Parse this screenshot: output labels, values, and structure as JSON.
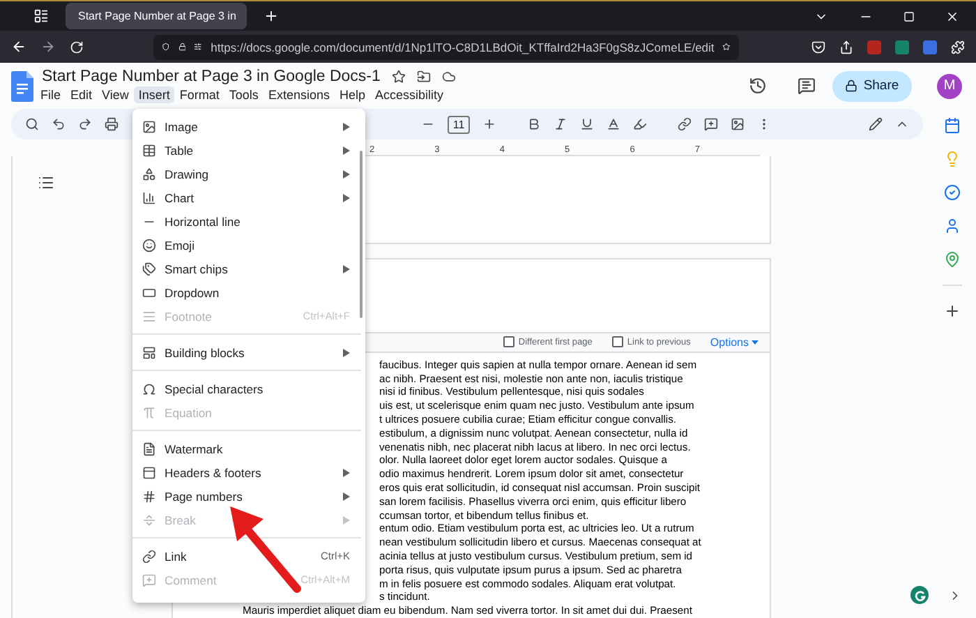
{
  "browser": {
    "tab_title": "Start Page Number at Page 3 in",
    "url": "https://docs.google.com/document/d/1Np1lTO-C8D1LBdOit_KTffaIrd2Ha3F0gS8zJComeLE/edit"
  },
  "document": {
    "title": "Start Page Number at Page 3 in Google Docs-1",
    "share_label": "Share",
    "avatar_initial": "M",
    "menus": [
      {
        "label": "File",
        "selected": false
      },
      {
        "label": "Edit",
        "selected": false
      },
      {
        "label": "View",
        "selected": false
      },
      {
        "label": "Insert",
        "selected": true
      },
      {
        "label": "Format",
        "selected": false
      },
      {
        "label": "Tools",
        "selected": false
      },
      {
        "label": "Extensions",
        "selected": false
      },
      {
        "label": "Help",
        "selected": false
      },
      {
        "label": "Accessibility",
        "selected": false
      }
    ]
  },
  "toolbar": {
    "font_size": "11"
  },
  "ruler": {
    "marks": [
      "2",
      "3",
      "4",
      "5",
      "6",
      "7"
    ]
  },
  "header_bar": {
    "options": [
      {
        "label": "Different first page",
        "checked": false
      },
      {
        "label": "Link to previous",
        "checked": false
      }
    ],
    "options_button": "Options"
  },
  "body_lines": [
    {
      "kind": "fragment",
      "text": "faucibus. Integer quis sapien at nulla tempor ornare. Aenean id sem"
    },
    {
      "kind": "fragment",
      "text": "ac nibh. Praesent est nisi, molestie non ante non, iaculis tristique"
    },
    {
      "kind": "fragment",
      "text": "nisi id finibus. Vestibulum pellentesque, nisi quis sodales"
    },
    {
      "kind": "fragment",
      "text": "uis est, ut scelerisque enim quam nec justo. Vestibulum ante ipsum"
    },
    {
      "kind": "fragment",
      "text": "t ultrices posuere cubilia curae; Etiam efficitur congue convallis."
    },
    {
      "kind": "fragment",
      "text": "estibulum, a dignissim nunc volutpat. Aenean consectetur, nulla id"
    },
    {
      "kind": "fragment",
      "text": "venenatis nibh, nec placerat nibh lacus at libero. In nec orci lectus."
    },
    {
      "kind": "fragment",
      "text": "olor. Nulla laoreet dolor eget lorem auctor sodales. Quisque a"
    },
    {
      "kind": "fragment",
      "text": "odio maximus hendrerit. Lorem ipsum dolor sit amet, consectetur"
    },
    {
      "kind": "fragment",
      "text": "eros quis erat sollicitudin, id consequat nisl accumsan. Proin suscipit"
    },
    {
      "kind": "fragment",
      "text": "san lorem facilisis. Phasellus viverra orci enim, quis efficitur libero"
    },
    {
      "kind": "fragment",
      "text": "ccumsan tortor, et bibendum tellus finibus et."
    },
    {
      "kind": "fragment",
      "text": "entum odio. Etiam vestibulum porta est, ac ultricies leo. Ut a rutrum"
    },
    {
      "kind": "fragment",
      "text": "nean vestibulum sollicitudin libero et cursus. Maecenas consequat at"
    },
    {
      "kind": "fragment",
      "text": "acinia tellus at justo vestibulum cursus. Vestibulum pretium, sem id"
    },
    {
      "kind": "fragment",
      "text": "porta risus, quis vulputate ipsum purus a ipsum. Sed ac pharetra"
    },
    {
      "kind": "fragment",
      "text": "m in felis posuere est commodo sodales. Aliquam erat volutpat."
    },
    {
      "kind": "fragment",
      "text": "s tincidunt."
    },
    {
      "kind": "full",
      "text": "Mauris imperdiet aliquet diam eu bibendum. Nam sed viverra tortor. In sit amet dui dui. Praesent"
    }
  ],
  "insert_menu": {
    "groups": [
      {
        "items": [
          {
            "label": "Image",
            "submenu": true,
            "disabled": false
          },
          {
            "label": "Table",
            "submenu": true,
            "disabled": false
          },
          {
            "label": "Drawing",
            "submenu": true,
            "disabled": false
          },
          {
            "label": "Chart",
            "submenu": true,
            "disabled": false
          },
          {
            "label": "Horizontal line",
            "submenu": false,
            "disabled": false
          },
          {
            "label": "Emoji",
            "submenu": false,
            "disabled": false
          },
          {
            "label": "Smart chips",
            "submenu": true,
            "disabled": false
          },
          {
            "label": "Dropdown",
            "submenu": false,
            "disabled": false
          },
          {
            "label": "Footnote",
            "submenu": false,
            "disabled": true,
            "shortcut": "Ctrl+Alt+F"
          }
        ]
      },
      {
        "items": [
          {
            "label": "Building blocks",
            "submenu": true,
            "disabled": false
          }
        ]
      },
      {
        "items": [
          {
            "label": "Special characters",
            "submenu": false,
            "disabled": false
          },
          {
            "label": "Equation",
            "submenu": false,
            "disabled": true
          }
        ]
      },
      {
        "items": [
          {
            "label": "Watermark",
            "submenu": false,
            "disabled": false
          },
          {
            "label": "Headers & footers",
            "submenu": true,
            "disabled": false
          },
          {
            "label": "Page numbers",
            "submenu": true,
            "disabled": false
          },
          {
            "label": "Break",
            "submenu": true,
            "disabled": true
          }
        ]
      },
      {
        "items": [
          {
            "label": "Link",
            "submenu": false,
            "disabled": false,
            "shortcut": "Ctrl+K"
          },
          {
            "label": "Comment",
            "submenu": false,
            "disabled": true,
            "shortcut": "Ctrl+Alt+M"
          }
        ]
      }
    ]
  }
}
